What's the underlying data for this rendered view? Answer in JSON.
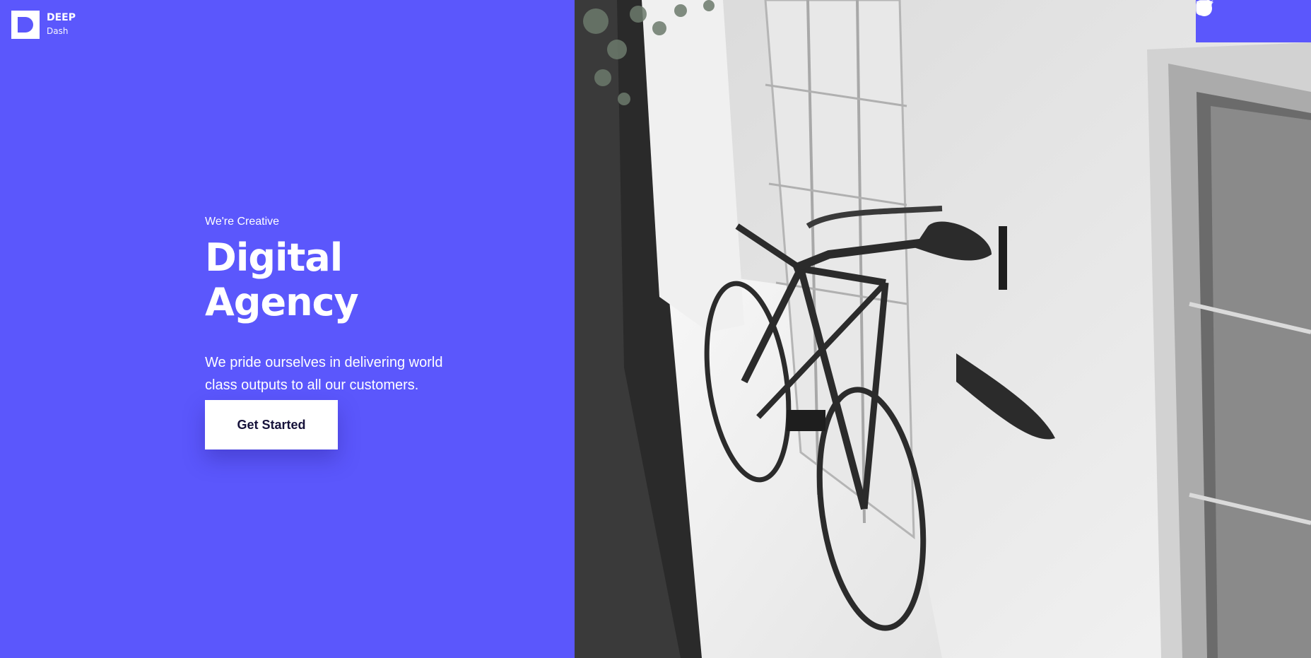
{
  "brand": {
    "name": "DEEP",
    "tagline": "Dash",
    "icon": "logo-d-icon"
  },
  "hero": {
    "eyebrow": "We're Creative",
    "headline": "Digital Agency",
    "lead": "We pride ourselves in delivering world class outputs to all our customers.",
    "cta_label": "Get Started"
  },
  "social": [
    {
      "icon": "facebook-icon"
    },
    {
      "icon": "twitter-icon"
    },
    {
      "icon": "instagram-icon"
    }
  ],
  "colors": {
    "accent": "#5b57fc",
    "button_text": "#16123a",
    "white": "#ffffff"
  }
}
